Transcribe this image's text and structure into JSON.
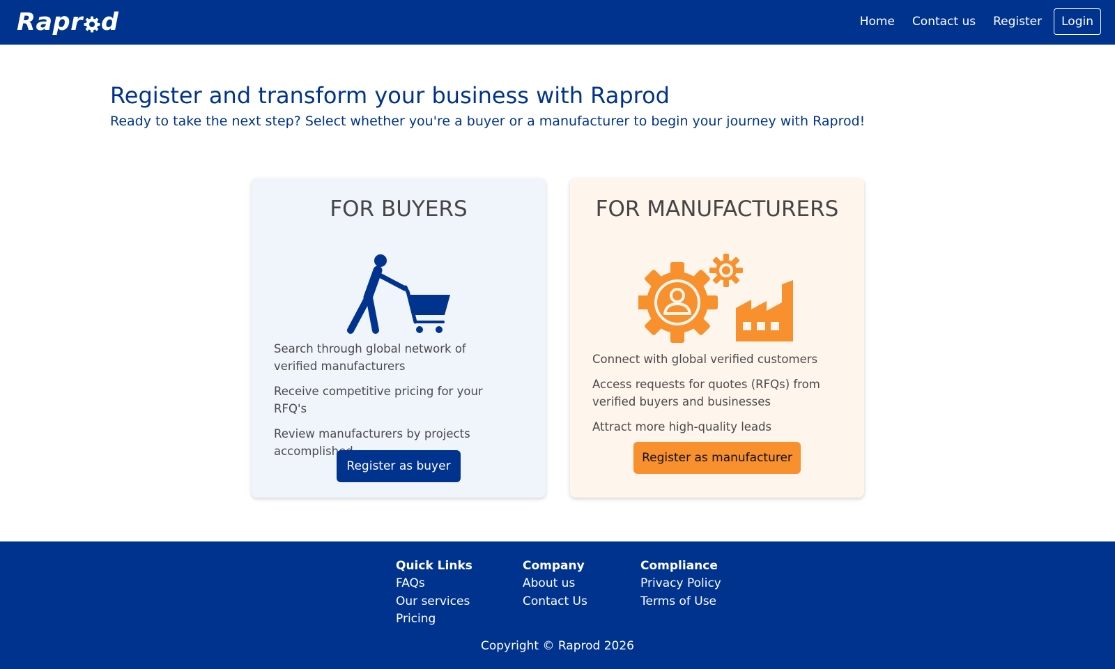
{
  "brand": {
    "name_part1": "Rapr",
    "name_part2": "d"
  },
  "nav": {
    "links": [
      "Home",
      "Contact us",
      "Register"
    ],
    "login_label": "Login"
  },
  "hero": {
    "title": "Register and transform your business with Raprod",
    "subtitle": "Ready to take the next step? Select whether you're a buyer or a manufacturer to begin your journey with Raprod!"
  },
  "buyers_card": {
    "title": "FOR BUYERS",
    "icon": "shopping-cart-person-icon",
    "features": [
      "Search through global network of verified manufacturers",
      "Receive competitive pricing for your RFQ's",
      "Review manufacturers by projects accomplished"
    ],
    "cta_label": "Register as buyer"
  },
  "manufacturers_card": {
    "title": "FOR MANUFACTURERS",
    "icon": "gear-factory-icon",
    "features": [
      "Connect with global verified customers",
      "Access requests for quotes (RFQs) from verified buyers and businesses",
      "Attract more high-quality leads"
    ],
    "cta_label": "Register as manufacturer"
  },
  "footer": {
    "columns": [
      {
        "heading": "Quick Links",
        "links": [
          "FAQs",
          "Our services",
          "Pricing"
        ]
      },
      {
        "heading": "Company",
        "links": [
          "About us",
          "Contact Us"
        ]
      },
      {
        "heading": "Compliance",
        "links": [
          "Privacy Policy",
          "Terms of Use"
        ]
      }
    ],
    "copyright": "Copyright © Raprod 2026"
  },
  "colors": {
    "primary_navy": "#00338d",
    "accent_orange": "#f7902d",
    "buyers_card_bg": "#f0f5fc",
    "manufacturers_card_bg": "#fef5ec"
  }
}
